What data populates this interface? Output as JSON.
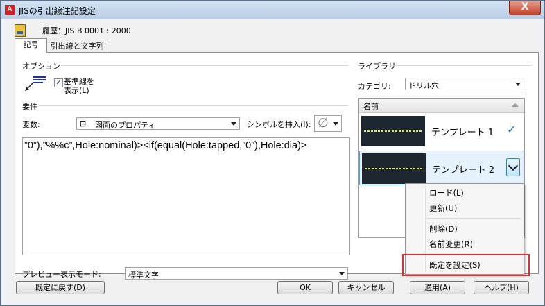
{
  "window": {
    "title": "JISの引出線注記設定",
    "close_symbol": "X",
    "app_letter": "A"
  },
  "history": {
    "label": "履歴：JIS B 0001 : 2000"
  },
  "tabs": [
    {
      "label": "記号"
    },
    {
      "label": "引出線と文字列"
    }
  ],
  "options": {
    "group_label": "オプション",
    "baseline_label_line1": "基準線を",
    "baseline_label_line2": "表示(L)",
    "baseline_checked": "✓"
  },
  "requirements": {
    "group_label": "要件",
    "variable_label": "変数:",
    "variable_value": "図面のプロパティ",
    "variable_expander": "⊞",
    "insert_symbol_label": "シンボルを挿入(I):",
    "symbol_value": "∅",
    "expression": "”0”),”%%c”,Hole:nominal)><if(equal(Hole:tapped,”0”),Hole:dia)>"
  },
  "preview": {
    "label": "プレビュー表示モード:",
    "value": "標準文字"
  },
  "library": {
    "group_label": "ライブラリ",
    "category_label": "カテゴリ:",
    "category_value": "ドリル穴",
    "column_header": "名前",
    "templates": [
      {
        "name": "テンプレート 1"
      },
      {
        "name": "テンプレート 2"
      }
    ]
  },
  "context_menu": {
    "items": [
      "ロード(L)",
      "更新(U)",
      "削除(D)",
      "名前変更(R)",
      "既定を設定(S)"
    ]
  },
  "buttons": {
    "restore_default": "既定に戻す(D)",
    "ok": "OK",
    "cancel": "キャンセル",
    "apply": "適用(A)",
    "help": "ヘルプ(H)"
  },
  "colors": {
    "highlight": "#e03030",
    "titlebar": "#c6d8ee",
    "thumbnail_bg": "#1e2630",
    "thumb_text": "#e5e54a"
  }
}
